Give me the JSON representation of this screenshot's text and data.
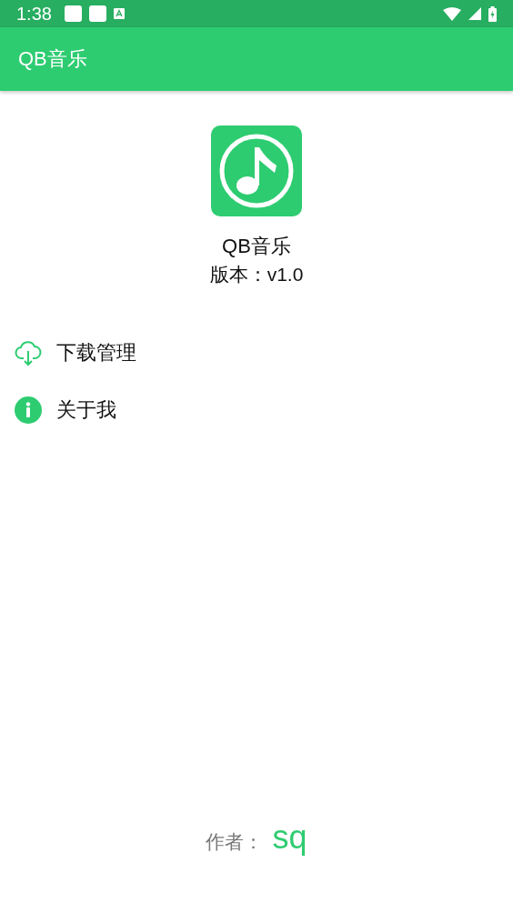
{
  "status_bar": {
    "time": "1:38"
  },
  "app_bar": {
    "title": "QB音乐"
  },
  "about": {
    "app_name": "QB音乐",
    "version": "版本：v1.0"
  },
  "menu": [
    {
      "label": "下载管理"
    },
    {
      "label": "关于我"
    }
  ],
  "footer": {
    "label": "作者：",
    "author": "sq"
  }
}
